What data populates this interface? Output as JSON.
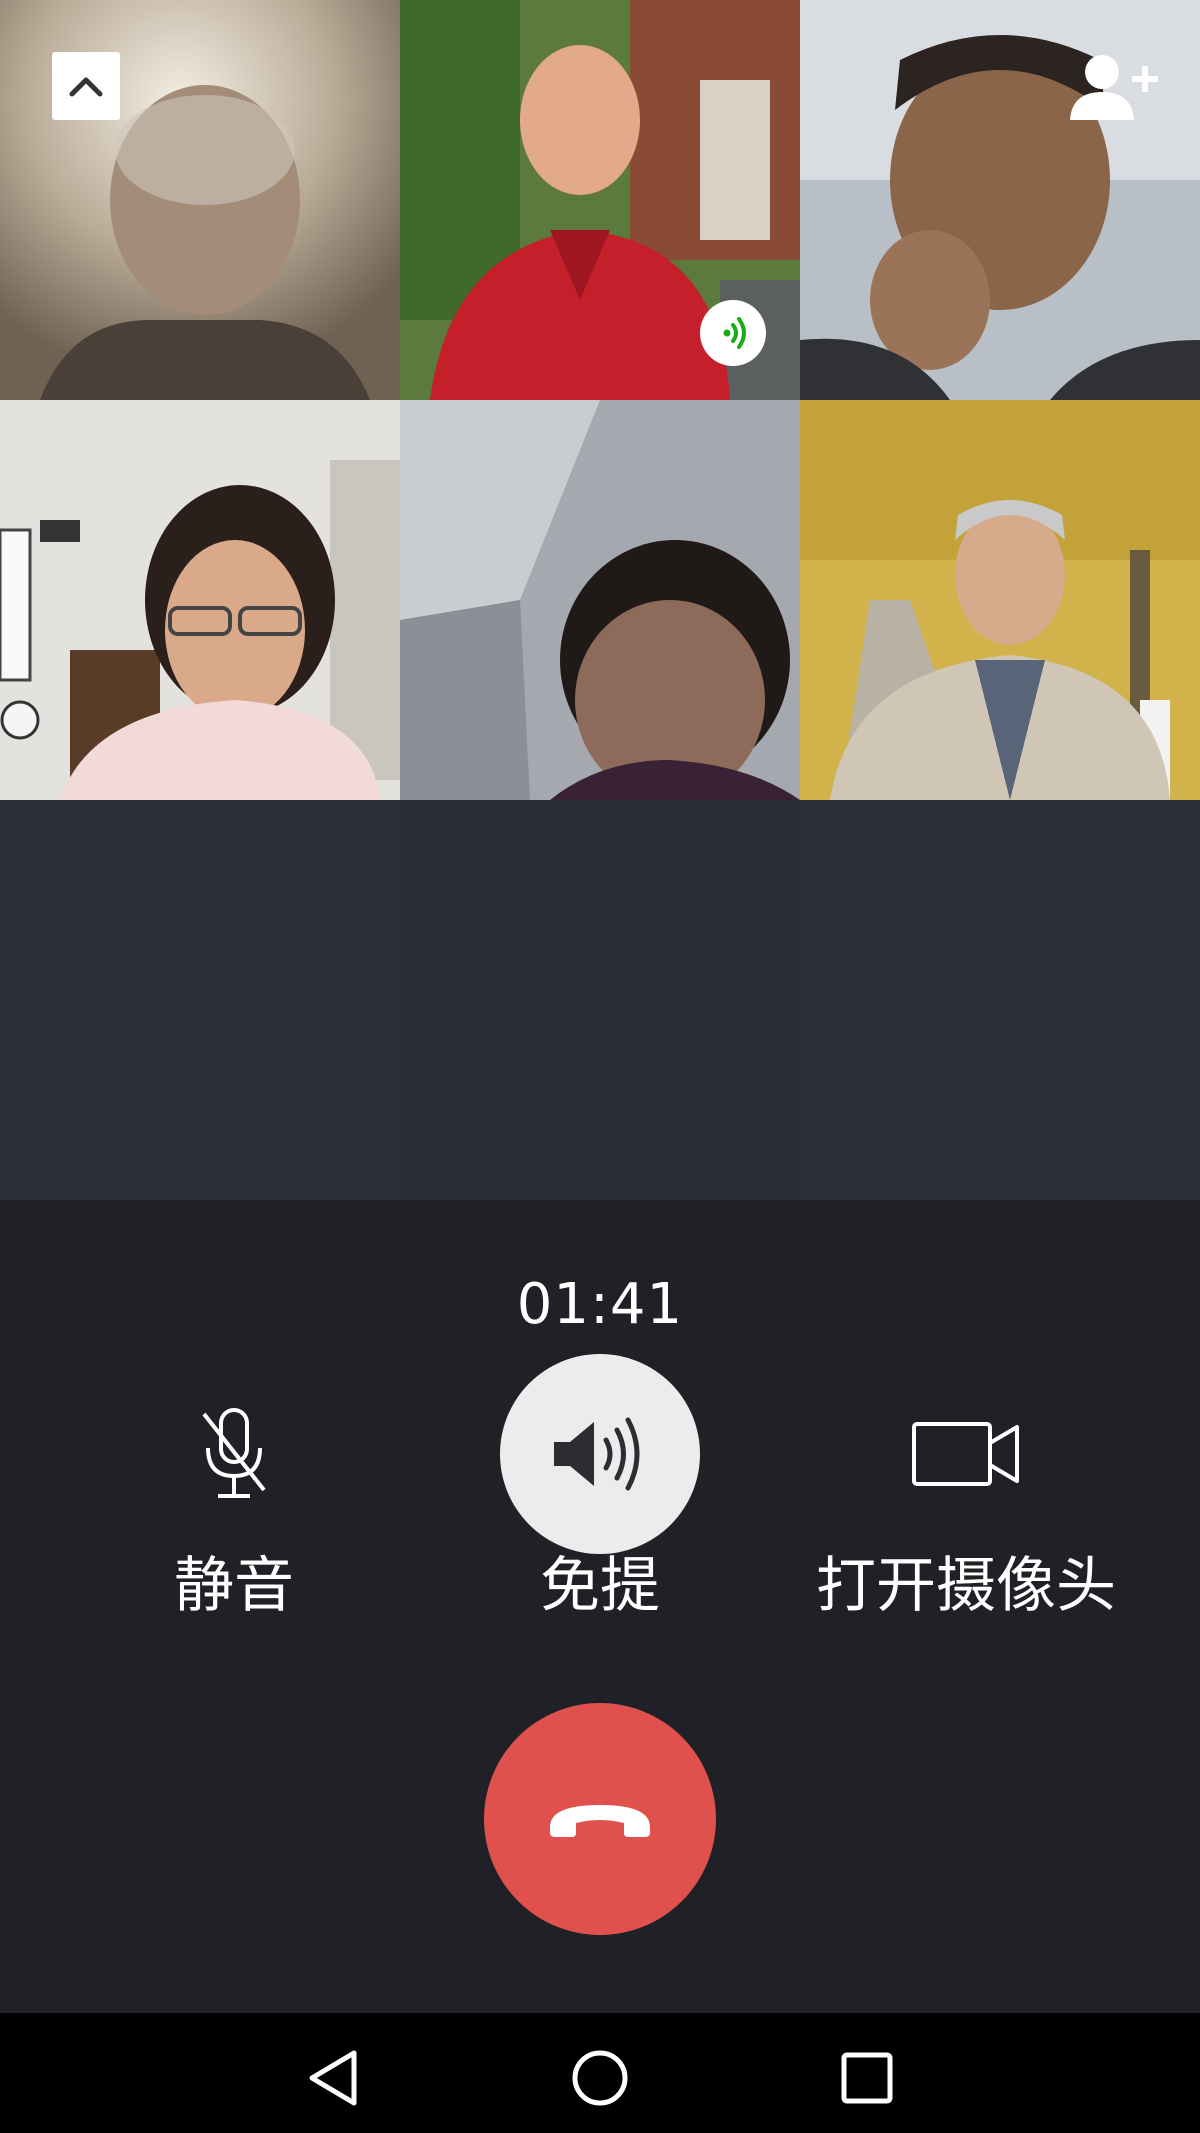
{
  "call": {
    "timer": "01:41",
    "speaking_icon": "speaking-waves-icon"
  },
  "participants": [
    {
      "name": "",
      "video": "on"
    },
    {
      "name": "",
      "video": "on",
      "speaking": true
    },
    {
      "name": "",
      "video": "on"
    },
    {
      "name": "",
      "video": "on"
    },
    {
      "name": "",
      "video": "on"
    },
    {
      "name": "",
      "video": "on"
    }
  ],
  "controls": {
    "mute_label": "静音",
    "speaker_label": "免提",
    "camera_label": "打开摄像头",
    "speaker_active": true
  },
  "icons": {
    "collapse": "chevron-up-icon",
    "add_member": "add-person-icon",
    "mute": "microphone-muted-icon",
    "speaker": "speaker-volume-icon",
    "camera": "video-camera-icon",
    "hangup": "phone-hangup-icon",
    "nav_back": "back-triangle-icon",
    "nav_home": "home-circle-icon",
    "nav_recent": "recent-apps-square-icon"
  },
  "colors": {
    "background": "#202127",
    "empty_tile": "#2e3038",
    "hangup": "#e0504d",
    "speaker_active_bg": "#ececec",
    "speaking_green": "#1aad19"
  }
}
